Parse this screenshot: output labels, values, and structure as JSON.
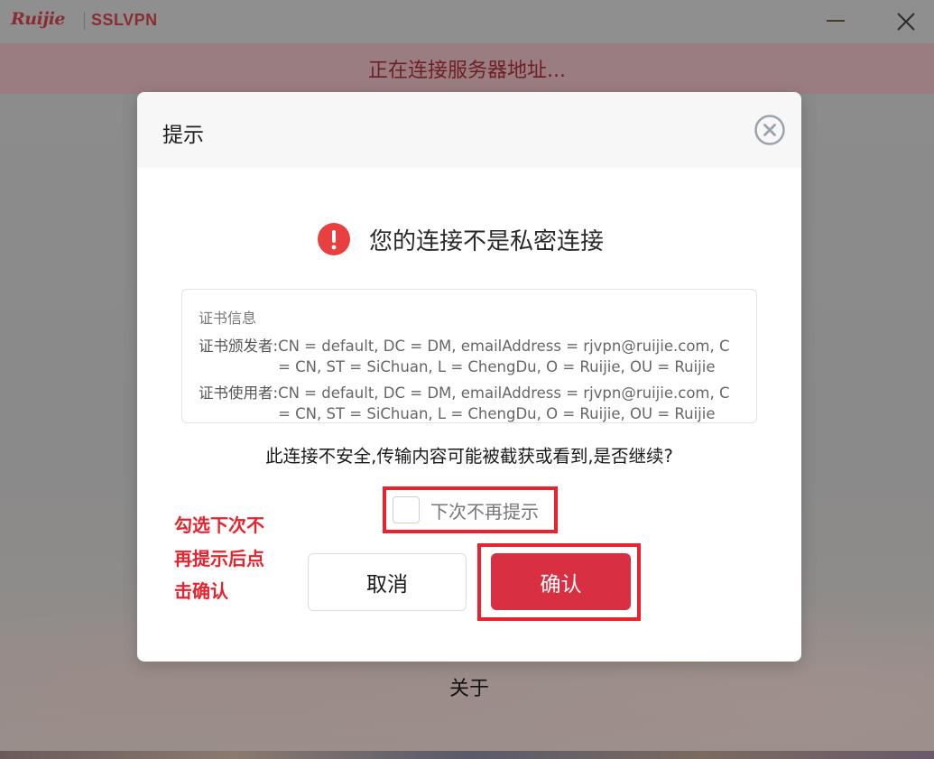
{
  "app": {
    "brand": "Ruijie",
    "product": "SSLVPN",
    "status_text": "正在连接服务器地址...",
    "about_label": "关于"
  },
  "dialog": {
    "title": "提示",
    "warning_title": "您的连接不是私密连接",
    "cert": {
      "heading": "证书信息",
      "issuer_label": "证书颁发者:",
      "issuer_value": "CN = default, DC = DM, emailAddress = rjvpn@ruijie.com, C = CN, ST = SiChuan, L = ChengDu, O = Ruijie, OU = Ruijie",
      "subject_label": "证书使用者:",
      "subject_value": "CN = default, DC = DM, emailAddress = rjvpn@ruijie.com, C = CN, ST = SiChuan, L = ChengDu, O = Ruijie, OU = Ruijie"
    },
    "question": "此连接不安全,传输内容可能被截获或看到,是否继续?",
    "remember_label": "下次不再提示",
    "remember_checked": false,
    "cancel_label": "取消",
    "confirm_label": "确认"
  },
  "annotation": {
    "line1": "勾选下次不",
    "line2": "再提示后点",
    "line3": "击确认"
  },
  "colors": {
    "brand": "#c8202f",
    "confirm_button": "#d92f42",
    "warning_icon": "#e84040",
    "annotation": "#e8232e"
  },
  "icons": {
    "minimize": "minimize-icon",
    "close": "close-icon",
    "dialog_close": "circle-close-icon",
    "warning": "exclamation-circle-icon"
  }
}
